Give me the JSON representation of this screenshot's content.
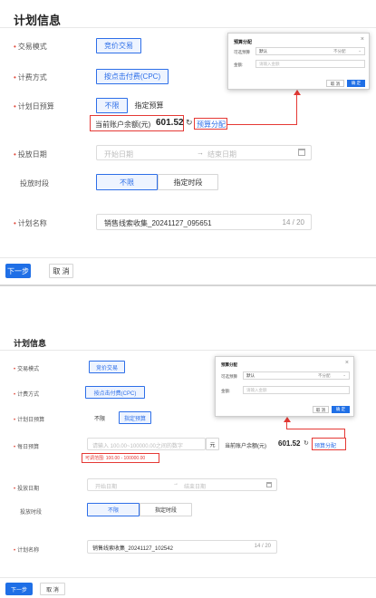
{
  "top": {
    "title": "计划信息",
    "trade_mode": {
      "label": "交易模式",
      "value": "竞价交易"
    },
    "billing": {
      "label": "计费方式",
      "value": "按点击付费(CPC)"
    },
    "daily_budget": {
      "label": "计划日预算",
      "options": [
        "不限",
        "指定预算"
      ],
      "selected": "不限"
    },
    "balance": {
      "label": "当前账户余额(元)",
      "value": "601.52",
      "link": "预算分配"
    },
    "date": {
      "label": "投放日期",
      "start_placeholder": "开始日期",
      "end_placeholder": "结束日期",
      "arrow": "→"
    },
    "period": {
      "label": "投放时段",
      "options": [
        "不限",
        "指定时段"
      ],
      "selected": "不限"
    },
    "plan_name": {
      "label": "计划名称",
      "value": "销售线索收集_20241127_095651",
      "count": "14 / 20"
    },
    "popup": {
      "title": "预算分配",
      "row1_label": "可选预算",
      "row1_value": "默认",
      "row1_unit": "不分配",
      "row2_label": "金额:",
      "row2_placeholder": "请输入金额",
      "cancel": "取 消",
      "ok": "确 定"
    },
    "footer": {
      "next": "下一步",
      "cancel": "取 消"
    }
  },
  "bottom": {
    "title": "计划信息",
    "trade_mode": {
      "label": "交易模式",
      "value": "竞价交易"
    },
    "billing": {
      "label": "计费方式",
      "value": "按点击付费(CPC)"
    },
    "daily_budget": {
      "label": "计划日预算",
      "options": [
        "不限",
        "指定预算"
      ],
      "selected": "指定预算"
    },
    "each_budget": {
      "label": "每日预算",
      "placeholder": "请输入 100.00~100000.00之间的数字",
      "unit": "元",
      "range_hint": "可调范围: 100.00 - 100000.00"
    },
    "balance": {
      "label": "当前账户余额(元)",
      "value": "601.52",
      "link": "预算分配"
    },
    "date": {
      "label": "投放日期",
      "start_placeholder": "开始日期",
      "end_placeholder": "结束日期",
      "arrow": "→"
    },
    "period": {
      "label": "投放时段",
      "options": [
        "不限",
        "指定时段"
      ],
      "selected": "不限"
    },
    "plan_name": {
      "label": "计划名称",
      "value": "销售线索收集_20241127_102542",
      "count": "14 / 20"
    },
    "popup": {
      "title": "预算分配",
      "row1_label": "可选预算",
      "row1_value": "默认",
      "row1_unit": "不分配",
      "row2_label": "金额:",
      "row2_placeholder": "请输入金额",
      "cancel": "取 消",
      "ok": "确 定"
    },
    "footer": {
      "next": "下一步",
      "cancel": "取 消"
    }
  },
  "icons": {
    "calendar": "calendar-icon",
    "refresh": "refresh-icon",
    "close": "close-icon",
    "chevron": "chevron-down-icon"
  },
  "colors": {
    "accent": "#2e6fe8",
    "primary": "#1f6fe6",
    "required": "#e0483a",
    "highlight": "#e53935"
  }
}
